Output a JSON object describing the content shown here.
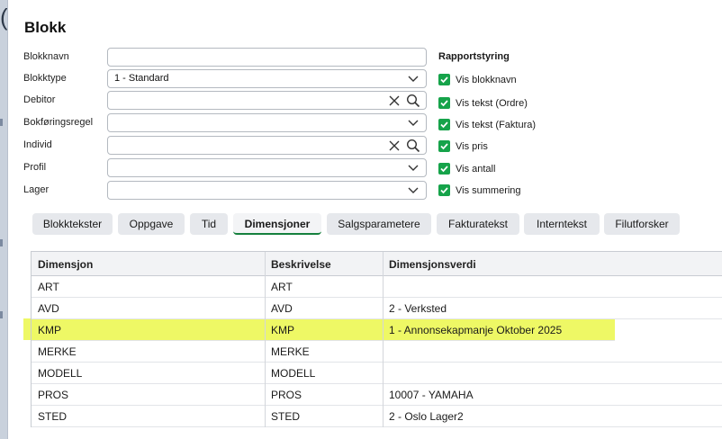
{
  "dialog": {
    "title": "Blokk",
    "fields": [
      {
        "label": "Blokknavn",
        "value": "",
        "type": "text"
      },
      {
        "label": "Blokktype",
        "value": "1 - Standard",
        "type": "select"
      },
      {
        "label": "Debitor",
        "value": "",
        "type": "lookup"
      },
      {
        "label": "Bokføringsregel",
        "value": "",
        "type": "select"
      },
      {
        "label": "Individ",
        "value": "",
        "type": "lookup"
      },
      {
        "label": "Profil",
        "value": "",
        "type": "select"
      },
      {
        "label": "Lager",
        "value": "",
        "type": "select"
      }
    ],
    "rapportstyring": {
      "title": "Rapportstyring",
      "options": [
        {
          "label": "Vis blokknavn",
          "checked": true
        },
        {
          "label": "Vis tekst (Ordre)",
          "checked": true
        },
        {
          "label": "Vis tekst (Faktura)",
          "checked": true
        },
        {
          "label": "Vis pris",
          "checked": true
        },
        {
          "label": "Vis antall",
          "checked": true
        },
        {
          "label": "Vis summering",
          "checked": true
        }
      ]
    },
    "tabs": [
      {
        "label": "Blokktekster",
        "active": false
      },
      {
        "label": "Oppgave",
        "active": false
      },
      {
        "label": "Tid",
        "active": false
      },
      {
        "label": "Dimensjoner",
        "active": true
      },
      {
        "label": "Salgsparametere",
        "active": false
      },
      {
        "label": "Fakturatekst",
        "active": false
      },
      {
        "label": "Interntekst",
        "active": false
      },
      {
        "label": "Filutforsker",
        "active": false
      }
    ],
    "grid": {
      "columns": [
        "Dimensjon",
        "Beskrivelse",
        "Dimensjonsverdi"
      ],
      "rows": [
        [
          "ART",
          "ART",
          ""
        ],
        [
          "AVD",
          "AVD",
          "2 - Verksted"
        ],
        [
          "KMP",
          "KMP",
          "1 - Annonsekapmanje Oktober 2025"
        ],
        [
          "MERKE",
          "MERKE",
          ""
        ],
        [
          "MODELL",
          "MODELL",
          ""
        ],
        [
          "PROS",
          "PROS",
          "10007 - YAMAHA"
        ],
        [
          "STED",
          "STED",
          "2 - Oslo Lager2"
        ]
      ],
      "highlighted_row": 2
    },
    "colors": {
      "accent": "#16a34a",
      "highlight": "#eef865"
    },
    "icons": {
      "clear": "close-icon",
      "search": "search-icon",
      "dropdown": "chevron-down-icon"
    }
  }
}
